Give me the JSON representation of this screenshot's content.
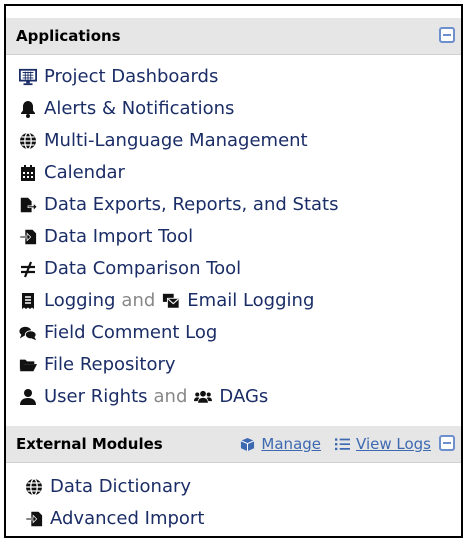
{
  "applications": {
    "title": "Applications",
    "items": [
      {
        "label": "Project Dashboards",
        "icon": "monitor-icon"
      },
      {
        "label": "Alerts & Notifications",
        "icon": "bell-icon"
      },
      {
        "label": "Multi-Language Management",
        "icon": "globe-icon"
      },
      {
        "label": "Calendar",
        "icon": "calendar-icon"
      },
      {
        "label": "Data Exports, Reports, and Stats",
        "icon": "file-export-icon"
      },
      {
        "label": "Data Import Tool",
        "icon": "file-import-icon"
      },
      {
        "label": "Data Comparison Tool",
        "icon": "not-equal-icon"
      },
      {
        "label": "Logging",
        "icon": "receipt-icon"
      },
      {
        "label": "Field Comment Log",
        "icon": "comments-icon"
      },
      {
        "label": "File Repository",
        "icon": "folder-open-icon"
      },
      {
        "label": "User Rights",
        "icon": "user-icon"
      }
    ],
    "logging_connector": "and",
    "email_logging_label": "Email Logging",
    "email_logging_icon": "mail-bulk-icon",
    "user_rights_connector": "and",
    "dags_label": "DAGs",
    "dags_icon": "users-icon"
  },
  "external_modules": {
    "title": "External Modules",
    "manage_label": "Manage",
    "manage_icon": "cube-icon",
    "view_logs_label": "View Logs",
    "view_logs_icon": "list-icon",
    "items": [
      {
        "label": "Data Dictionary",
        "icon": "globe-icon"
      },
      {
        "label": "Advanced Import",
        "icon": "file-import-icon"
      }
    ]
  },
  "colors": {
    "link": "#1b2d66",
    "header_bg": "#e6e6e6",
    "muted": "#888888",
    "accent": "#6d8fce"
  }
}
